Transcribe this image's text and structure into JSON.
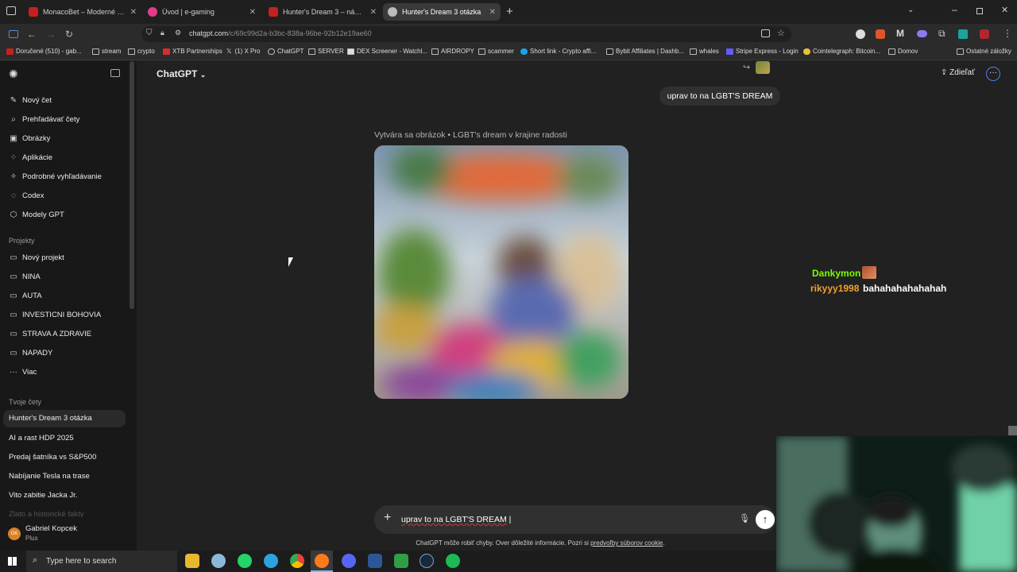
{
  "tabs": [
    {
      "label": "MonacoBet – Moderné Onli",
      "icon_color": "#c5221f"
    },
    {
      "label": "Úvod | e-gaming",
      "icon_color": "#e63a8a"
    },
    {
      "label": "Hunter's Dream 3 – návrh smer",
      "icon_color": "#c5221f"
    },
    {
      "label": "Hunter's Dream 3 otázka",
      "icon_color": "#bbbbbb"
    }
  ],
  "address": {
    "host": "chatgpt.com",
    "path": "/c/69c99d2a-b3bc-838a-96be-92b12e19ae60"
  },
  "bookmarks": [
    "Doručené (510) - gab...",
    "stream",
    "crypto",
    "XTB Partnerships",
    "(1) X Pro",
    "ChatGPT",
    "SERVER",
    "DEX Screener - Watchl...",
    "AIRDROPY",
    "scammer",
    "Short link - Crypto affi...",
    "Bybit Affiliates | Dashb...",
    "whales",
    "Stripe Express - Login",
    "Cointelegraph: Bitcoin...",
    "Domov",
    "Ostatné záložky"
  ],
  "sidebar": {
    "menu": [
      {
        "label": "Nový čet",
        "icon": "pencil-icon"
      },
      {
        "label": "Prehľadávať čety",
        "icon": "search-icon"
      },
      {
        "label": "Obrázky",
        "icon": "image-icon"
      },
      {
        "label": "Aplikácie",
        "icon": "apps-icon"
      },
      {
        "label": "Podrobné vyhľadávanie",
        "icon": "telescope-icon"
      },
      {
        "label": "Codex",
        "icon": "codex-icon"
      },
      {
        "label": "Modely GPT",
        "icon": "cube-icon"
      }
    ],
    "projects_heading": "Projekty",
    "projects": [
      "Nový projekt",
      "NINA",
      "AUTA",
      "INVESTICNI BOHOVIA",
      "STRAVA A ZDRAVIE",
      "NAPADY",
      "Viac"
    ],
    "chats_heading": "Tvoje čety",
    "chats": [
      "Hunter's Dream 3 otázka",
      "AI a rast HDP 2025",
      "Predaj šatníka vs S&P500",
      "Nabíjanie Tesla na trase",
      "Vito zabitie Jacka Jr.",
      "Zlato a historické fakty"
    ],
    "user": {
      "name": "Gabriel Kopcek",
      "plan": "Plus",
      "initials": "GK"
    }
  },
  "main": {
    "model": "ChatGPT",
    "share": "Zdieľať",
    "user_message": "uprav to na LGBT'S DREAM",
    "image_caption": "Vytvára sa obrázok • LGBT's dream v krajine radosti",
    "composer_text": "uprav to na LGBT'S DREAM",
    "disclaimer": "ChatGPT môže robiť chyby. Over dôležité informácie. Pozri si",
    "disclaimer_link": "predvoľby súborov cookie"
  },
  "overlay_chat": [
    {
      "user": "Dankymon",
      "message": "",
      "color": "#7CFC00"
    },
    {
      "user": "rikyyy1998",
      "message": "bahahahahahahah",
      "color": "#f0a030"
    }
  ],
  "taskbar": {
    "search_placeholder": "Type here to search"
  }
}
